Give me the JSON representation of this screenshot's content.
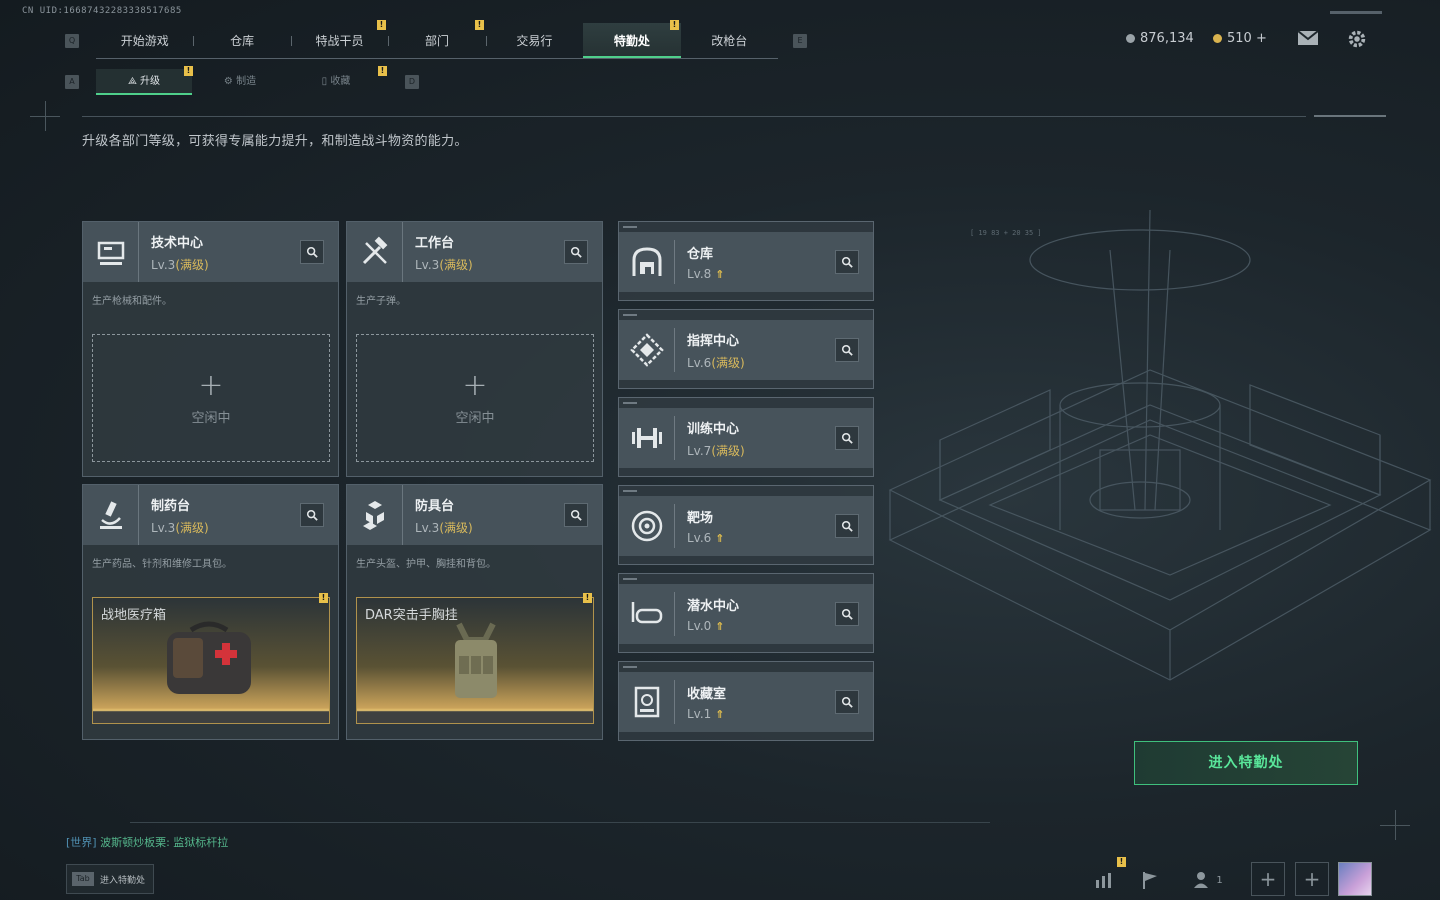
{
  "uid_text": "CN UID:16687432283338517685",
  "nav": {
    "key_left": "Q",
    "key_right": "E",
    "tabs": [
      {
        "label": "开始游戏",
        "alert": false
      },
      {
        "label": "仓库",
        "alert": false
      },
      {
        "label": "特战干员",
        "alert": true
      },
      {
        "label": "部门",
        "alert": true
      },
      {
        "label": "交易行",
        "alert": false
      },
      {
        "label": "特勤处",
        "alert": true,
        "active": true
      },
      {
        "label": "改枪台",
        "alert": false
      }
    ]
  },
  "subnav": {
    "key_left": "A",
    "key_right": "D",
    "tabs": [
      {
        "label": "升级",
        "alert": true,
        "active": true
      },
      {
        "label": "制造",
        "alert": false
      },
      {
        "label": "收藏",
        "alert": true
      }
    ]
  },
  "currency": {
    "silver": "876,134",
    "gold": "510 +"
  },
  "description": "升级各部门等级，可获得专属能力提升，和制造战斗物资的能力。",
  "production_cards": [
    {
      "name": "技术中心",
      "level": "Lv.3",
      "max": "(满级)",
      "desc": "生产枪械和配件。",
      "slot": {
        "state": "idle",
        "label": "空闲中"
      }
    },
    {
      "name": "工作台",
      "level": "Lv.3",
      "max": "(满级)",
      "desc": "生产子弹。",
      "slot": {
        "state": "idle",
        "label": "空闲中"
      }
    },
    {
      "name": "制药台",
      "level": "Lv.3",
      "max": "(满级)",
      "desc": "生产药品、针剂和维修工具包。",
      "slot": {
        "state": "item",
        "label": "战地医疗箱",
        "alert": true
      }
    },
    {
      "name": "防具台",
      "level": "Lv.3",
      "max": "(满级)",
      "desc": "生产头盔、护甲、胸挂和背包。",
      "slot": {
        "state": "item",
        "label": "DAR突击手胸挂",
        "alert": true
      }
    }
  ],
  "facility_cards": [
    {
      "name": "仓库",
      "level": "Lv.8",
      "max": "",
      "upgradable": true,
      "icon": "vault-icon"
    },
    {
      "name": "指挥中心",
      "level": "Lv.6",
      "max": "(满级)",
      "upgradable": false,
      "icon": "command-icon"
    },
    {
      "name": "训练中心",
      "level": "Lv.7",
      "max": "(满级)",
      "upgradable": false,
      "icon": "dumbbell-icon"
    },
    {
      "name": "靶场",
      "level": "Lv.6",
      "max": "",
      "upgradable": true,
      "icon": "target-icon"
    },
    {
      "name": "潜水中心",
      "level": "Lv.0",
      "max": "",
      "upgradable": true,
      "icon": "diving-mask-icon"
    },
    {
      "name": "收藏室",
      "level": "Lv.1",
      "max": "",
      "upgradable": true,
      "icon": "collection-icon"
    }
  ],
  "enter_button": "进入特勤处",
  "chat": {
    "channel": "[世界]",
    "text": "波斯顿炒板栗: 监狱标杆拉"
  },
  "tab_hint": {
    "key": "Tab",
    "label": "进入特勤处"
  },
  "bottom_bar": {
    "friends_count": "1"
  },
  "colors": {
    "accent": "#4fd08b",
    "gold": "#d8b95c",
    "alert": "#e8c04a"
  }
}
